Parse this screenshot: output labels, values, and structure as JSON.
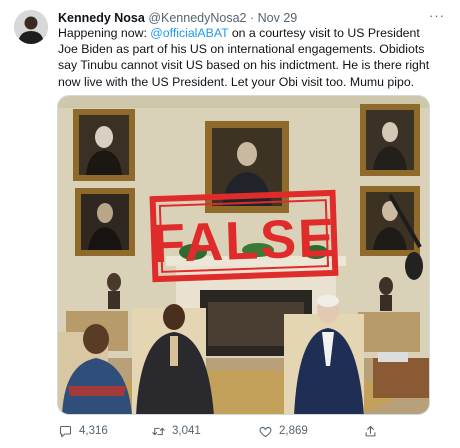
{
  "tweet": {
    "author_name": "Kennedy Nosa",
    "author_handle": "@KennedyNosa2",
    "separator": "·",
    "date": "Nov 29",
    "more_label": "···",
    "text_before_mention": "Happening now: ",
    "mention": "@officialABAT",
    "text_after_mention": " on a courtesy visit to US President Joe Biden as part of his US on international engagements. Obidiots say Tinubu cannot visit US based on his indictment. He is there right now live with the US President. Let your Obi visit too. Mumu pipo.",
    "media": {
      "stamp_text": "FALSE",
      "stamp_color": "#e02b2b"
    },
    "actions": {
      "replies": "4,316",
      "retweets": "3,041",
      "likes": "2,869"
    },
    "icons": [
      "comment-icon",
      "retweet-icon",
      "heart-icon",
      "share-icon",
      "more-icon"
    ]
  }
}
